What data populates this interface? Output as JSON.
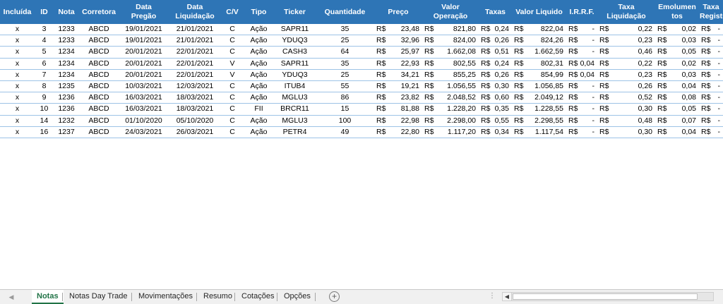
{
  "headers": [
    "Incluída",
    "ID",
    "Nota",
    "Corretora",
    "Data\nPregão",
    "Data\nLiquidação",
    "C/V",
    "Tipo",
    "Ticker",
    "Quantidade",
    "Preço",
    "Valor\nOperação",
    "Taxas",
    "Valor Liquido",
    "I.R.R.F.",
    "Taxa\nLiquidação",
    "Emolumen\ntos",
    "Taxa\nRegistro"
  ],
  "currency_symbol": "R$",
  "rows": [
    {
      "incl": "x",
      "id": "3",
      "nota": "1233",
      "corretora": "ABCD",
      "pregao": "19/01/2021",
      "liquidacao": "21/01/2021",
      "cv": "C",
      "tipo": "Ação",
      "ticker": "SAPR11",
      "qtd": "35",
      "preco": "23,48",
      "valor_op": "821,80",
      "taxas": "0,24",
      "valor_liq": "822,04",
      "irrf": "-",
      "taxa_liq": "0,22",
      "emol": "0,02",
      "taxa_reg": "-"
    },
    {
      "incl": "x",
      "id": "4",
      "nota": "1233",
      "corretora": "ABCD",
      "pregao": "19/01/2021",
      "liquidacao": "21/01/2021",
      "cv": "C",
      "tipo": "Ação",
      "ticker": "YDUQ3",
      "qtd": "25",
      "preco": "32,96",
      "valor_op": "824,00",
      "taxas": "0,26",
      "valor_liq": "824,26",
      "irrf": "-",
      "taxa_liq": "0,23",
      "emol": "0,03",
      "taxa_reg": "-"
    },
    {
      "incl": "x",
      "id": "5",
      "nota": "1234",
      "corretora": "ABCD",
      "pregao": "20/01/2021",
      "liquidacao": "22/01/2021",
      "cv": "C",
      "tipo": "Ação",
      "ticker": "CASH3",
      "qtd": "64",
      "preco": "25,97",
      "valor_op": "1.662,08",
      "taxas": "0,51",
      "valor_liq": "1.662,59",
      "irrf": "-",
      "taxa_liq": "0,46",
      "emol": "0,05",
      "taxa_reg": "-"
    },
    {
      "incl": "x",
      "id": "6",
      "nota": "1234",
      "corretora": "ABCD",
      "pregao": "20/01/2021",
      "liquidacao": "22/01/2021",
      "cv": "V",
      "tipo": "Ação",
      "ticker": "SAPR11",
      "qtd": "35",
      "preco": "22,93",
      "valor_op": "802,55",
      "taxas": "0,24",
      "valor_liq": "802,31",
      "irrf": "0,04",
      "taxa_liq": "0,22",
      "emol": "0,02",
      "taxa_reg": "-"
    },
    {
      "incl": "x",
      "id": "7",
      "nota": "1234",
      "corretora": "ABCD",
      "pregao": "20/01/2021",
      "liquidacao": "22/01/2021",
      "cv": "V",
      "tipo": "Ação",
      "ticker": "YDUQ3",
      "qtd": "25",
      "preco": "34,21",
      "valor_op": "855,25",
      "taxas": "0,26",
      "valor_liq": "854,99",
      "irrf": "0,04",
      "taxa_liq": "0,23",
      "emol": "0,03",
      "taxa_reg": "-"
    },
    {
      "incl": "x",
      "id": "8",
      "nota": "1235",
      "corretora": "ABCD",
      "pregao": "10/03/2021",
      "liquidacao": "12/03/2021",
      "cv": "C",
      "tipo": "Ação",
      "ticker": "ITUB4",
      "qtd": "55",
      "preco": "19,21",
      "valor_op": "1.056,55",
      "taxas": "0,30",
      "valor_liq": "1.056,85",
      "irrf": "-",
      "taxa_liq": "0,26",
      "emol": "0,04",
      "taxa_reg": "-"
    },
    {
      "incl": "x",
      "id": "9",
      "nota": "1236",
      "corretora": "ABCD",
      "pregao": "16/03/2021",
      "liquidacao": "18/03/2021",
      "cv": "C",
      "tipo": "Ação",
      "ticker": "MGLU3",
      "qtd": "86",
      "preco": "23,82",
      "valor_op": "2.048,52",
      "taxas": "0,60",
      "valor_liq": "2.049,12",
      "irrf": "-",
      "taxa_liq": "0,52",
      "emol": "0,08",
      "taxa_reg": "-"
    },
    {
      "incl": "x",
      "id": "10",
      "nota": "1236",
      "corretora": "ABCD",
      "pregao": "16/03/2021",
      "liquidacao": "18/03/2021",
      "cv": "C",
      "tipo": "FII",
      "ticker": "BRCR11",
      "qtd": "15",
      "preco": "81,88",
      "valor_op": "1.228,20",
      "taxas": "0,35",
      "valor_liq": "1.228,55",
      "irrf": "-",
      "taxa_liq": "0,30",
      "emol": "0,05",
      "taxa_reg": "-"
    },
    {
      "incl": "x",
      "id": "14",
      "nota": "1232",
      "corretora": "ABCD",
      "pregao": "01/10/2020",
      "liquidacao": "05/10/2020",
      "cv": "C",
      "tipo": "Ação",
      "ticker": "MGLU3",
      "qtd": "100",
      "preco": "22,98",
      "valor_op": "2.298,00",
      "taxas": "0,55",
      "valor_liq": "2.298,55",
      "irrf": "-",
      "taxa_liq": "0,48",
      "emol": "0,07",
      "taxa_reg": "-"
    },
    {
      "incl": "x",
      "id": "16",
      "nota": "1237",
      "corretora": "ABCD",
      "pregao": "24/03/2021",
      "liquidacao": "26/03/2021",
      "cv": "C",
      "tipo": "Ação",
      "ticker": "PETR4",
      "qtd": "49",
      "preco": "22,80",
      "valor_op": "1.117,20",
      "taxas": "0,34",
      "valor_liq": "1.117,54",
      "irrf": "-",
      "taxa_liq": "0,30",
      "emol": "0,04",
      "taxa_reg": "-"
    }
  ],
  "sheet_tabs": [
    "Notas",
    "Notas Day Trade",
    "Movimentações",
    "Resumo",
    "Cotações",
    "Opções"
  ],
  "active_tab": "Notas",
  "icons": {
    "prev_sheet": "triangle-left-icon",
    "add_sheet": "plus-circle-icon",
    "options": "ellipsis-icon",
    "scroll_left": "triangle-left-icon"
  },
  "colors": {
    "header_bg": "#2e75b6",
    "header_text": "#ffffff",
    "row_border": "#9dc3e6",
    "active_tab": "#217346"
  }
}
